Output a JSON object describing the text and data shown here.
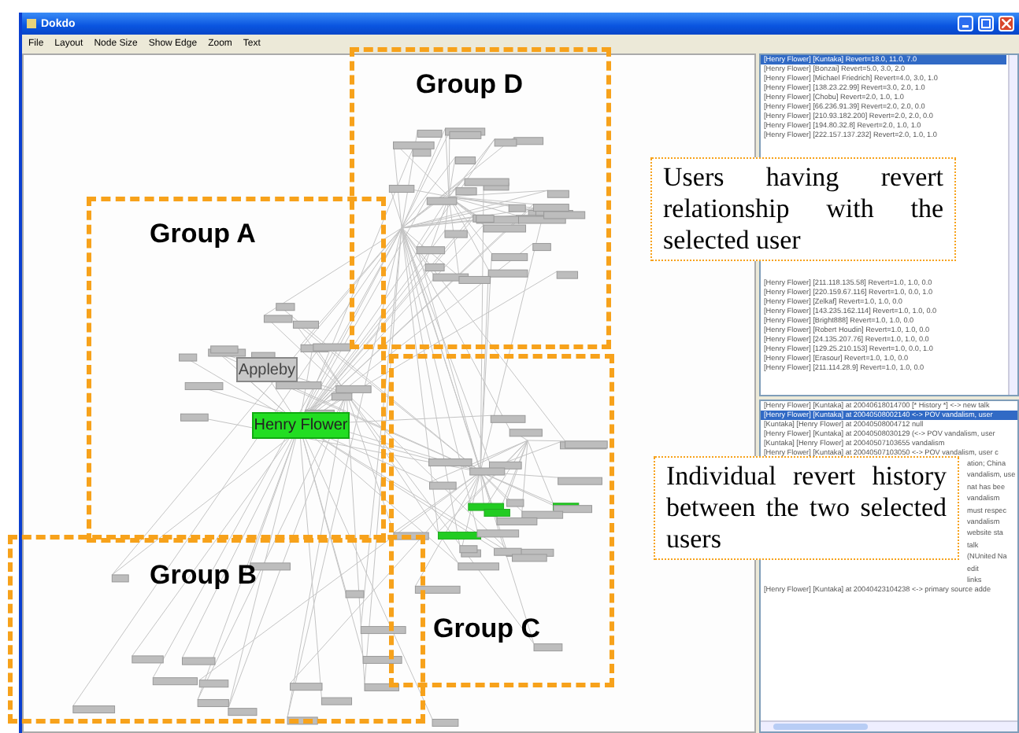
{
  "window": {
    "title": "Dokdo"
  },
  "menu": [
    "File",
    "Layout",
    "Node Size",
    "Show Edge",
    "Zoom",
    "Text"
  ],
  "graph": {
    "nodes": [
      {
        "label": "Appleby",
        "highlighted": false
      },
      {
        "label": "Henry Flower",
        "highlighted": true
      }
    ]
  },
  "user_list": {
    "rows": [
      {
        "text": "[Henry Flower] [Kuntaka] Revert=18.0, 11.0, 7.0",
        "selected": true
      },
      {
        "text": "[Henry Flower] [Bonzai] Revert=5.0, 3.0, 2.0",
        "selected": false
      },
      {
        "text": "[Henry Flower] [Michael Friedrich] Revert=4.0, 3.0, 1.0",
        "selected": false
      },
      {
        "text": "[Henry Flower] [138.23.22.99] Revert=3.0, 2.0, 1.0",
        "selected": false
      },
      {
        "text": "[Henry Flower] [Chobu] Revert=2.0, 1.0, 1.0",
        "selected": false
      },
      {
        "text": "[Henry Flower] [66.236.91.39] Revert=2.0, 2.0, 0.0",
        "selected": false
      },
      {
        "text": "[Henry Flower] [210.93.182.200] Revert=2.0, 2.0, 0.0",
        "selected": false
      },
      {
        "text": "[Henry Flower] [194.80.32.8] Revert=2.0, 1.0, 1.0",
        "selected": false
      },
      {
        "text": "[Henry Flower] [222.157.137.232] Revert=2.0, 1.0, 1.0",
        "selected": false
      },
      {
        "text": "[Henry Flower] [211.118.135.58] Revert=1.0, 1.0, 0.0",
        "selected": false
      },
      {
        "text": "[Henry Flower] [220.159.67.116] Revert=1.0, 0.0, 1.0",
        "selected": false
      },
      {
        "text": "[Henry Flower] [Zelkaf] Revert=1.0, 1.0, 0.0",
        "selected": false
      },
      {
        "text": "[Henry Flower] [143.235.162.114] Revert=1.0, 1.0, 0.0",
        "selected": false
      },
      {
        "text": "[Henry Flower] [Bright888] Revert=1.0, 1.0, 0.0",
        "selected": false
      },
      {
        "text": "[Henry Flower] [Robert Houdin] Revert=1.0, 1.0, 0.0",
        "selected": false
      },
      {
        "text": "[Henry Flower] [24.135.207.76] Revert=1.0, 1.0, 0.0",
        "selected": false
      },
      {
        "text": "[Henry Flower] [129.25.210.153] Revert=1.0, 0.0, 1.0",
        "selected": false
      },
      {
        "text": "[Henry Flower] [Erasour] Revert=1.0, 1.0, 0.0",
        "selected": false
      },
      {
        "text": "[Henry Flower] [211.114.28.9] Revert=1.0, 1.0, 0.0",
        "selected": false
      }
    ]
  },
  "history_list": {
    "rows": [
      {
        "kind": "row",
        "text": "[Henry Flower] [Kuntaka] at 20040618014700 [* History *] <-> new talk",
        "selected": false
      },
      {
        "kind": "row",
        "text": "[Henry Flower] [Kuntaka] at 20040508002140 <-> POV vandalism, user",
        "selected": true
      },
      {
        "kind": "row",
        "text": "[Kuntaka] [Henry Flower] at 20040508004712 null",
        "selected": false
      },
      {
        "kind": "row",
        "text": "[Henry Flower] [Kuntaka] at 20040508030129 (<-> POV vandalism, user",
        "selected": false
      },
      {
        "kind": "row",
        "text": "[Kuntaka] [Henry Flower] at 20040507103655 vandalism",
        "selected": false
      },
      {
        "kind": "row",
        "text": "[Henry Flower] [Kuntaka] at 20040507103050 <-> POV vandalism, user c",
        "selected": false
      },
      {
        "kind": "fragment",
        "text": "ation; China"
      },
      {
        "kind": "fragment",
        "text": "vandalism, use"
      },
      {
        "kind": "fragment",
        "text": "nat has bee"
      },
      {
        "kind": "fragment",
        "text": "vandalism"
      },
      {
        "kind": "fragment",
        "text": "must respec"
      },
      {
        "kind": "fragment",
        "text": "vandalism"
      },
      {
        "kind": "fragment",
        "text": "website sta"
      },
      {
        "kind": "fragment",
        "text": "talk"
      },
      {
        "kind": "fragment",
        "text": "(NUnited Na"
      },
      {
        "kind": "fragment",
        "text": "edit"
      },
      {
        "kind": "fragment",
        "text": "links"
      },
      {
        "kind": "row",
        "text": "[Henry Flower] [Kuntaka] at 20040423104238 <-> primary source adde",
        "selected": false
      }
    ]
  },
  "annotations": {
    "groups": [
      "Group D",
      "Group A",
      "Group B",
      "Group C"
    ],
    "callouts": [
      "Users having revert relationship with the selected user",
      "Individual revert history between the two selected users"
    ]
  }
}
